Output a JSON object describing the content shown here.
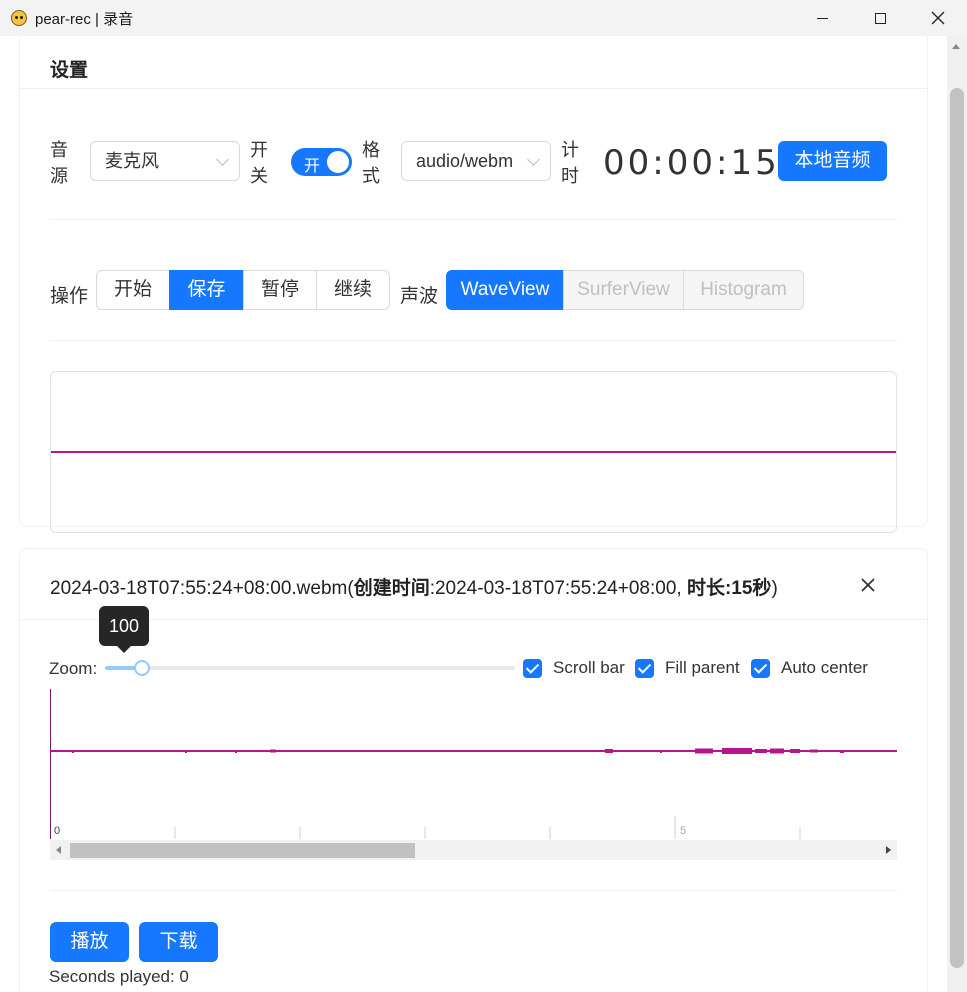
{
  "window": {
    "title": "pear-rec | 录音",
    "minimize_icon": "minimize-icon",
    "maximize_icon": "maximize-icon",
    "close_icon": "close-icon"
  },
  "settings": {
    "title": "设置",
    "source_label": "音源",
    "source_value": "麦克风",
    "switch_label": "开关",
    "switch_text": "开",
    "switch_on": true,
    "format_label": "格式",
    "format_value": "audio/webm",
    "timer_label": "计时",
    "timer_value": "00:00:15",
    "local_audio_button": "本地音频",
    "ops_label": "操作",
    "ops": [
      {
        "label": "开始",
        "active": false
      },
      {
        "label": "保存",
        "active": true
      },
      {
        "label": "暂停",
        "active": false
      },
      {
        "label": "继续",
        "active": false
      }
    ],
    "wave_label": "声波",
    "wave_views": [
      {
        "label": "WaveView",
        "state": "active"
      },
      {
        "label": "SurferView",
        "state": "disabled"
      },
      {
        "label": "Histogram",
        "state": "disabled"
      }
    ],
    "wave_color": "#b5168f"
  },
  "recording": {
    "filename": "2024-03-18T07:55:24+08:00.webm",
    "paren_open": "(",
    "created_label": "创建时间",
    "colon": ":",
    "created_value": "2024-03-18T07:55:24+08:00, ",
    "duration_label": "时长",
    "duration_value": "15秒",
    "paren_close": ")",
    "close_icon": "close-icon",
    "zoom_label": "Zoom:",
    "zoom_value": "100",
    "zoom_fraction": 0.09,
    "checkboxes": [
      {
        "label": "Scroll bar",
        "checked": true
      },
      {
        "label": "Fill parent",
        "checked": true
      },
      {
        "label": "Auto center",
        "checked": true
      }
    ],
    "timeline_labels": [
      "0",
      "5"
    ],
    "waveform_color": "#b5168f",
    "play_button": "播放",
    "download_button": "下载",
    "seconds_played": "Seconds played: 0"
  },
  "accent_color": "#1677ff"
}
